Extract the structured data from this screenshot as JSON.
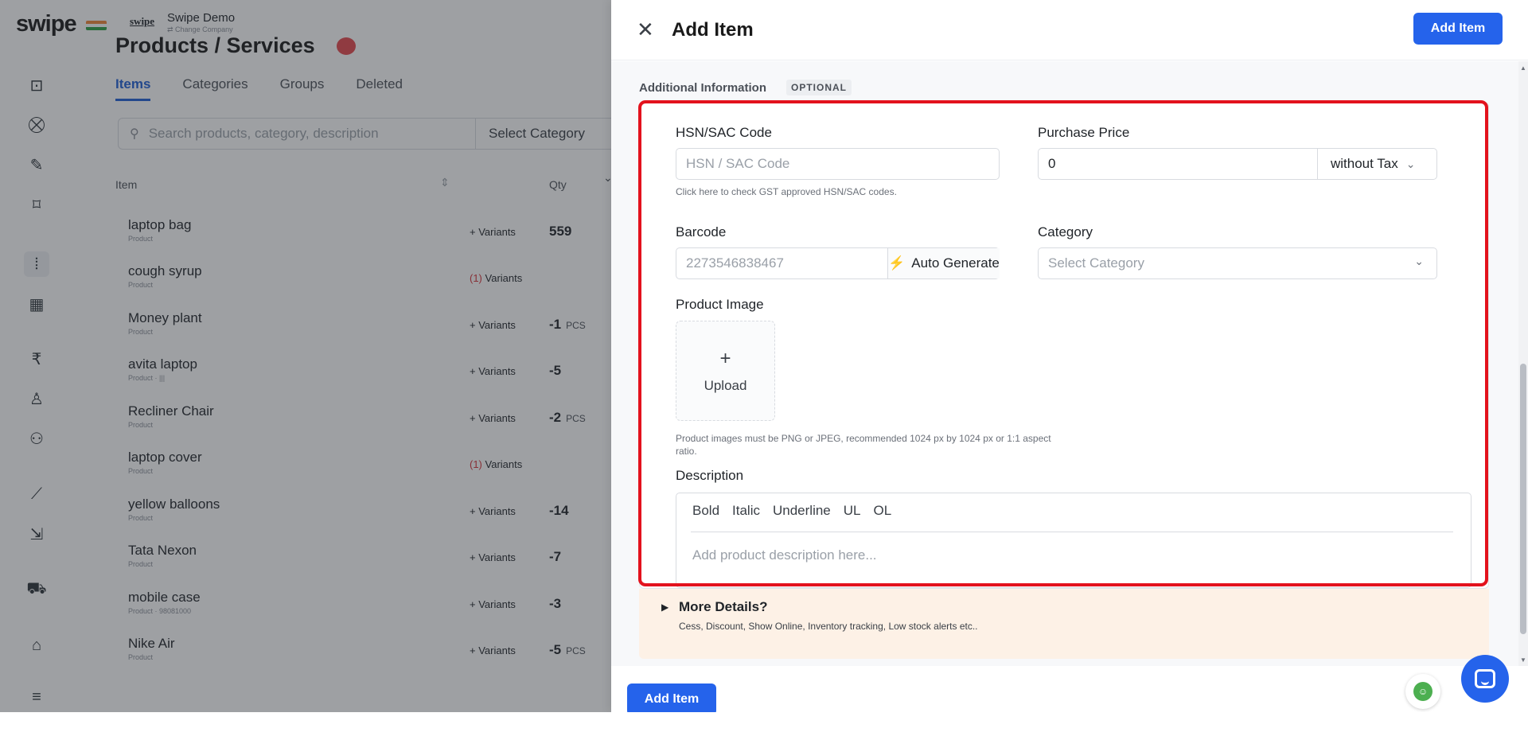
{
  "app": {
    "logo_text": "swipe",
    "company_logo": "swipe",
    "company_name": "Swipe Demo",
    "company_change": "⇄ Change Company"
  },
  "page": {
    "title": "Products / Services",
    "tabs": [
      {
        "label": "Items"
      },
      {
        "label": "Categories"
      },
      {
        "label": "Groups"
      },
      {
        "label": "Deleted"
      }
    ],
    "search_placeholder": "Search products, category, description",
    "category_select": "Select Category",
    "table": {
      "col_item": "Item",
      "col_qty": "Qty",
      "rows": [
        {
          "name": "laptop bag",
          "sub": "Product",
          "variants": "+ Variants",
          "variant_count": "",
          "qty": "559",
          "unit": ""
        },
        {
          "name": "cough syrup",
          "sub": "Product",
          "variants": "Variants",
          "variant_count": "(1)",
          "qty": "",
          "unit": ""
        },
        {
          "name": "Money plant",
          "sub": "Product",
          "variants": "+ Variants",
          "variant_count": "",
          "qty": "-1",
          "unit": "PCS"
        },
        {
          "name": "avita laptop",
          "sub": "Product · |||",
          "variants": "+ Variants",
          "variant_count": "",
          "qty": "-5",
          "unit": ""
        },
        {
          "name": "Recliner Chair",
          "sub": "Product",
          "variants": "+ Variants",
          "variant_count": "",
          "qty": "-2",
          "unit": "PCS"
        },
        {
          "name": "laptop cover",
          "sub": "Product",
          "variants": "Variants",
          "variant_count": "(1)",
          "qty": "",
          "unit": ""
        },
        {
          "name": "yellow balloons",
          "sub": "Product",
          "variants": "+ Variants",
          "variant_count": "",
          "qty": "-14",
          "unit": ""
        },
        {
          "name": "Tata Nexon",
          "sub": "Product",
          "variants": "+ Variants",
          "variant_count": "",
          "qty": "-7",
          "unit": ""
        },
        {
          "name": "mobile case",
          "sub": "Product · 98081000",
          "variants": "+ Variants",
          "variant_count": "",
          "qty": "-3",
          "unit": ""
        },
        {
          "name": "Nike Air",
          "sub": "Product",
          "variants": "+ Variants",
          "variant_count": "",
          "qty": "-5",
          "unit": "PCS"
        }
      ]
    }
  },
  "sidebar_icons": [
    "cash-icon",
    "cart-icon",
    "pencil-icon",
    "tag-icon",
    "barcode-scan-icon",
    "warehouse-icon",
    "rupee-icon",
    "user-icon",
    "users-icon",
    "chart-icon",
    "import-icon",
    "truck-icon",
    "store-icon",
    "menu-icon"
  ],
  "drawer": {
    "close_glyph": "✕",
    "title": "Add Item",
    "add_button": "Add Item",
    "section_label": "Additional Information",
    "optional_badge": "OPTIONAL",
    "hsn": {
      "label": "HSN/SAC Code",
      "placeholder": "HSN / SAC Code",
      "hint": "Click here to check GST approved HSN/SAC codes."
    },
    "purchase_price": {
      "label": "Purchase Price",
      "value": "0",
      "tax_option": "without Tax"
    },
    "barcode": {
      "label": "Barcode",
      "placeholder": "2273546838467",
      "auto_generate": "Auto Generate"
    },
    "category": {
      "label": "Category",
      "placeholder": "Select Category"
    },
    "image": {
      "label": "Product Image",
      "upload": "Upload",
      "hint": "Product images must be PNG or JPEG, recommended 1024 px by 1024 px or 1:1 aspect ratio."
    },
    "description": {
      "label": "Description",
      "toolbar": [
        "Bold",
        "Italic",
        "Underline",
        "UL",
        "OL"
      ],
      "placeholder": "Add product description here..."
    },
    "more_details": {
      "title": "More Details?",
      "subtitle": "Cess, Discount, Show Online, Inventory tracking, Low stock alerts etc.."
    },
    "add_button_bottom": "Add Item"
  },
  "colors": {
    "accent": "#2563eb",
    "highlight": "#e3121d",
    "more_bg": "#fdf1e6"
  }
}
